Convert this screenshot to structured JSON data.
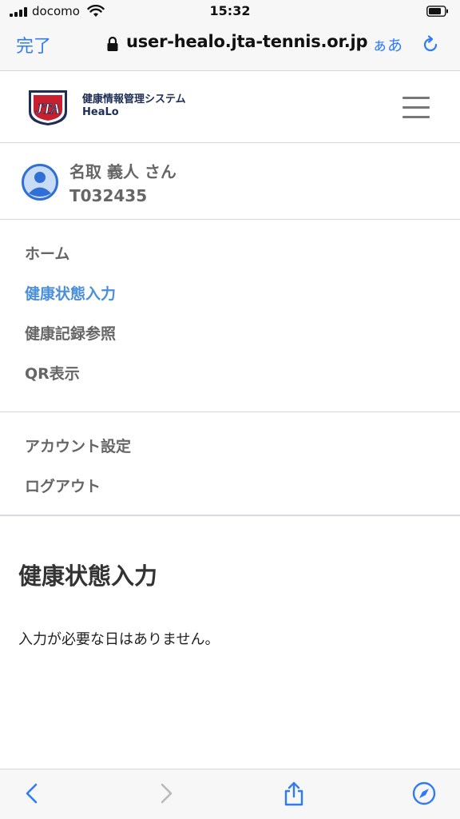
{
  "status_bar": {
    "carrier": "docomo",
    "time": "15:32"
  },
  "browser": {
    "done_label": "完了",
    "url": "user-healo.jta-tennis.or.jp",
    "text_size_label": "ぁあ"
  },
  "header": {
    "logo_text": "JTA",
    "system_name": "健康情報管理システム",
    "system_short": "HeaLo"
  },
  "profile": {
    "name": "名取 義人 さん",
    "id": "T032435"
  },
  "nav": {
    "main": [
      "ホーム",
      "健康状態入力",
      "健康記録参照",
      "QR表示"
    ],
    "active": "健康状態入力",
    "account": [
      "アカウント設定",
      "ログアウト"
    ]
  },
  "content": {
    "title": "健康状態入力",
    "message": "入力が必要な日はありません。"
  },
  "colors": {
    "accent": "#2f7bf5",
    "active_nav": "#4a8fdc",
    "brand_navy": "#1e2d56",
    "brand_red": "#c8202e"
  }
}
